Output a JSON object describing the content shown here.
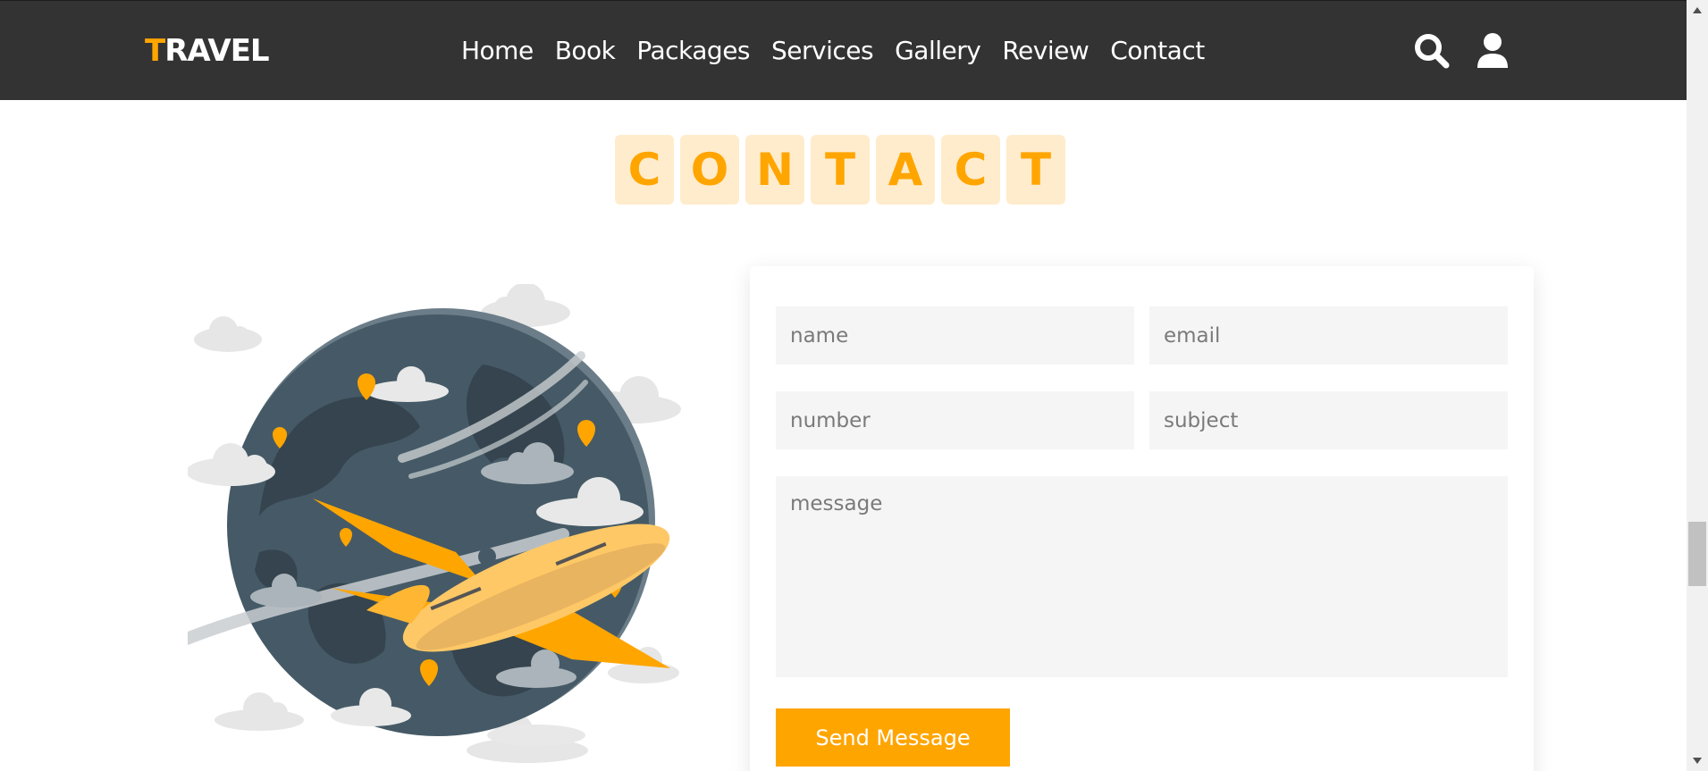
{
  "brand": {
    "first_letter": "T",
    "rest": "RAVEL"
  },
  "nav": [
    "Home",
    "Book",
    "Packages",
    "Services",
    "Gallery",
    "Review",
    "Contact"
  ],
  "header_icons": [
    "search-icon",
    "user-icon"
  ],
  "heading_letters": [
    "C",
    "O",
    "N",
    "T",
    "A",
    "C",
    "T"
  ],
  "form": {
    "name_placeholder": "name",
    "email_placeholder": "email",
    "number_placeholder": "number",
    "subject_placeholder": "subject",
    "message_placeholder": "message",
    "submit_label": "Send Message"
  },
  "colors": {
    "accent": "#ffa500",
    "header_bg": "#333333",
    "tile_bg": "#ffeccc",
    "field_bg": "#f5f5f5"
  }
}
